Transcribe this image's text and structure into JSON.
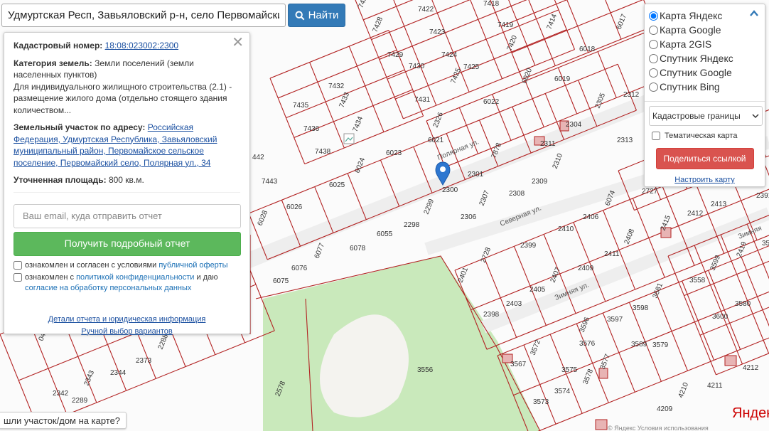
{
  "search": {
    "value": "Удмуртская Респ, Завьяловский р-н, село Первомайский, у",
    "button_label": "Найти"
  },
  "info": {
    "cadastral_label": "Кадастровый номер:",
    "cadastral_number": "18:08:023002:2300",
    "category_label": "Категория земель:",
    "category_value": "Земли поселений (земли населенных пунктов)",
    "usage": "Для индивидуального жилищного строительства (2.1) - размещение жилого дома (отдельно стоящего здания количеством...",
    "address_label": "Земельный участок по адресу:",
    "address": "Российская Федерация, Удмуртская Республика, Завьяловский муниципальный район, Первомайское сельское поселение, Первомайский село, Полярная ул., 34",
    "area_label": "Уточненная площадь:",
    "area_value": "800 кв.м.",
    "email_placeholder": "Ваш email, куда отправить отчет",
    "report_button": "Получить подробный отчет",
    "agree1_text": "ознакомлен и согласен с условиями",
    "agree1_link": "публичной оферты",
    "agree2_text": "ознакомлен с",
    "agree2_link": "политикой конфиденциальности",
    "agree2_tail": "и даю",
    "agree2_link2": "согласие на обработку персональных данных",
    "details_link": "Детали отчета и юридическая информация",
    "manual_link": "Ручной выбор вариантов"
  },
  "layers": {
    "options": [
      "Карта Яндекс",
      "Карта Google",
      "Карта 2GIS",
      "Спутник Яндекс",
      "Спутник Google",
      "Спутник Bing"
    ],
    "selected": "Карта Яндекс",
    "boundary_select": "Кадастровые границы",
    "thematic_label": "Тематическая карта",
    "share_button": "Поделиться ссылкой",
    "config_link": "Настроить карту"
  },
  "found_button": "шли участок/дом на карте?",
  "map": {
    "provider_logo": "Яндекс",
    "copyright": "© Яндекс Условия использования",
    "streets": [
      "Полярная ул.",
      "Северная ул.",
      "Зимняя ул.",
      "Зимняя"
    ],
    "parcels": [
      "7427",
      "7422",
      "7418",
      "7428",
      "7423",
      "7419",
      "7414",
      "7429",
      "7424",
      "7420",
      "7430",
      "7425",
      "7425",
      "7431",
      "7432",
      "7433",
      "7435",
      "7436",
      "7434",
      "7438",
      "6023",
      "6024",
      "6025",
      "6026",
      "6028",
      "442",
      "7443",
      "7878",
      "2300",
      "2301",
      "2299",
      "2298",
      "2306",
      "2307",
      "2308",
      "2309",
      "2310",
      "2311",
      "2304",
      "2305",
      "2312",
      "2313",
      "2326",
      "6021",
      "6022",
      "6020",
      "6019",
      "6018",
      "6017",
      "6055",
      "6078",
      "6077",
      "6076",
      "6075",
      "6074",
      "2410",
      "2406",
      "2408",
      "2411",
      "2409",
      "2407",
      "2405",
      "2403",
      "2401",
      "2398",
      "2399",
      "2728",
      "2727",
      "2412",
      "2415",
      "2413",
      "2391",
      "2419",
      "3557",
      "3558",
      "3599",
      "3600",
      "3580",
      "3581",
      "3598",
      "3597",
      "3596",
      "3589",
      "3579",
      "3577",
      "3576",
      "3575",
      "3578",
      "3574",
      "3573",
      "3572",
      "3567",
      "3556",
      "2578",
      "2373",
      "2344",
      "2343",
      "2342",
      "2289",
      "2288",
      "4212",
      "4211",
      "4210",
      "4209",
      "692",
      "046"
    ],
    "colors": {
      "parcel_line": "#b22222",
      "park": "#c5e8b7",
      "road": "#e7e5e1"
    }
  }
}
